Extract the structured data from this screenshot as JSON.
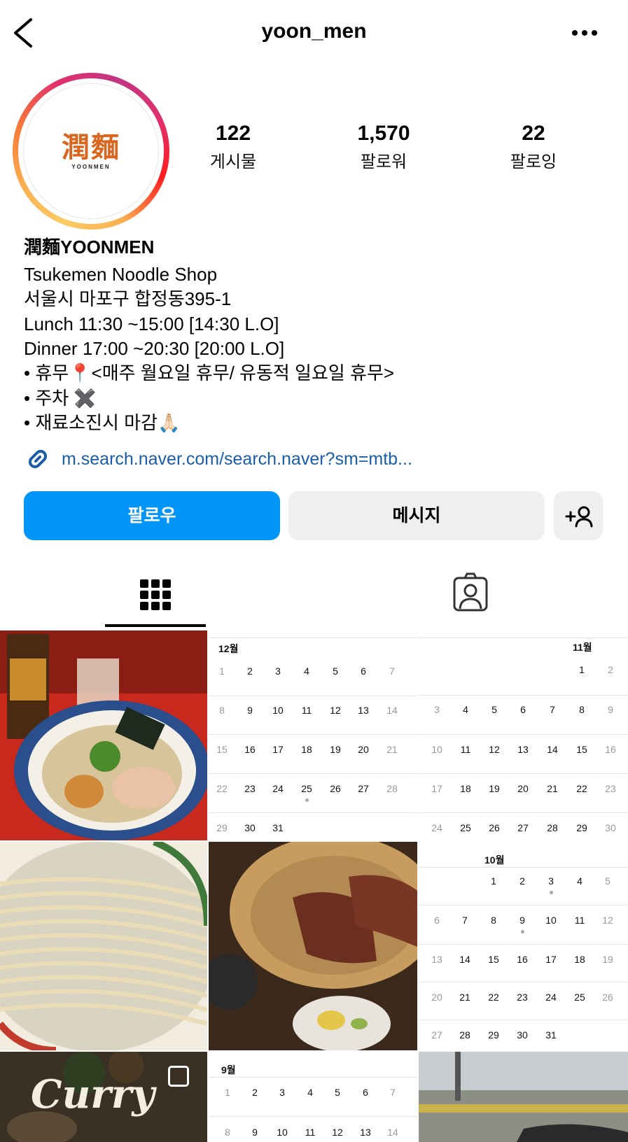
{
  "header": {
    "username": "yoon_men",
    "back_icon": "chevron-left-icon",
    "more_icon": "more-horizontal-icon"
  },
  "avatar": {
    "logo_text": "潤麵",
    "logo_subtext": "YOONMEN",
    "logo_color": "#d9661f"
  },
  "stats": [
    {
      "value": "122",
      "label": "게시물"
    },
    {
      "value": "1,570",
      "label": "팔로워"
    },
    {
      "value": "22",
      "label": "팔로잉"
    }
  ],
  "bio": {
    "name": "潤麵YOONMEN",
    "lines": [
      "Tsukemen Noodle Shop",
      "서울시 마포구 합정동395-1",
      "Lunch 11:30 ~15:00 [14:30 L.O]",
      "Dinner 17:00 ~20:30 [20:00 L.O]",
      "• 휴무📍<매주 월요일 휴무/ 유동적 일요일 휴무>",
      "• 주차 ✖️",
      "• 재료소진시 마감🙏🏻"
    ],
    "link": "m.search.naver.com/search.naver?sm=mtb..."
  },
  "actions": {
    "follow": "팔로우",
    "message": "메시지",
    "add_user_icon": "add-user-icon"
  },
  "tabs": {
    "grid_icon": "grid-icon",
    "tagged_icon": "tagged-person-icon"
  },
  "colors": {
    "primary_blue": "#0095f6",
    "link_blue": "#1a5da8",
    "secondary_button": "#efefef",
    "highlight_pink": "#ff82aa"
  },
  "posts": {
    "curry_text": "Curry",
    "calendars": {
      "december": {
        "month": "12월"
      },
      "november": {
        "month": "11월"
      },
      "october": {
        "month": "10월"
      },
      "september": {
        "month": "9월"
      }
    }
  }
}
